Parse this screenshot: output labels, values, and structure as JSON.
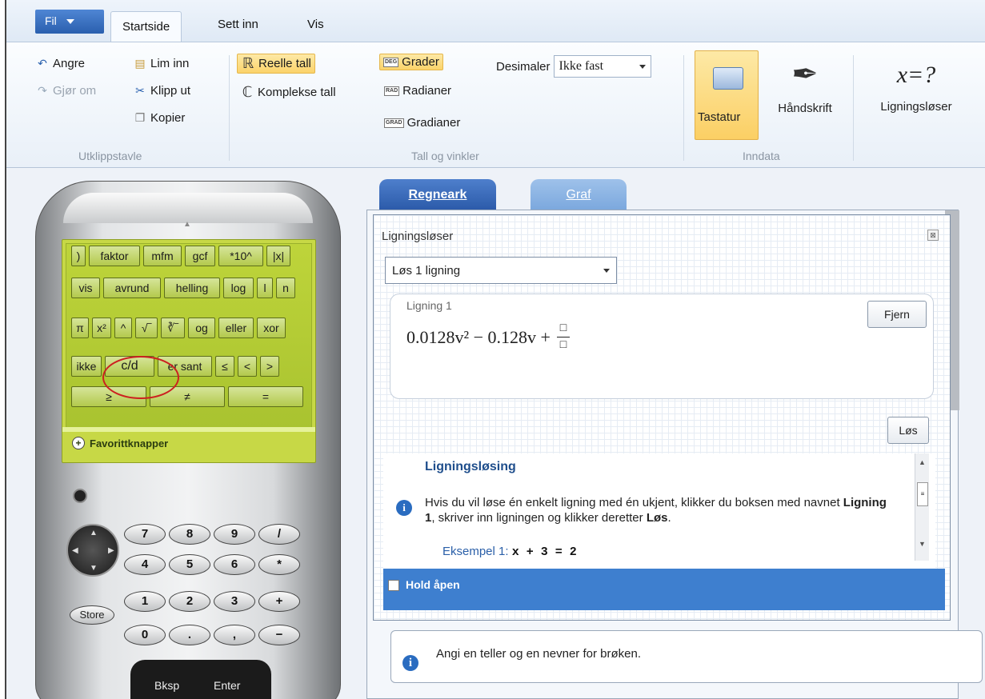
{
  "ribbon": {
    "file_menu": "Fil",
    "tabs": [
      "Startside",
      "Sett inn",
      "Vis"
    ],
    "clipboard": {
      "undo": "Angre",
      "redo": "Gjør om",
      "paste": "Lim inn",
      "cut": "Klipp ut",
      "copy": "Kopier",
      "group": "Utklippstavle"
    },
    "numbers": {
      "real": "Reelle tall",
      "complex": "Komplekse tall",
      "degrees": "Grader",
      "radians": "Radianer",
      "gradians": "Gradianer",
      "deg_badge": "DEG",
      "rad_badge": "RAD",
      "grad_badge": "GRAD",
      "decimals_label": "Desimaler",
      "decimals_value": "Ikke fast",
      "group": "Tall og vinkler"
    },
    "input": {
      "keyboard": "Tastatur",
      "handwriting": "Håndskrift",
      "group": "Inndata"
    },
    "solver": {
      "symbol": "x=?",
      "label": "Ligningsløser"
    }
  },
  "calculator": {
    "rows": [
      [
        ")",
        "faktor",
        "mfm",
        "gcf",
        "*10^",
        "|x|"
      ],
      [
        "vis",
        "avrund",
        "helling",
        "log",
        "l",
        "n"
      ],
      [
        "π",
        "x²",
        "^",
        "√‾",
        "∛‾",
        "og",
        "eller",
        "xor"
      ],
      [
        "ikke",
        "c/d",
        "er sant",
        "≤",
        "<",
        ">"
      ],
      [
        "≥",
        "≠",
        "="
      ]
    ],
    "favorites": "Favorittknapper",
    "numpad": [
      [
        "7",
        "8",
        "9",
        "/"
      ],
      [
        "4",
        "5",
        "6",
        "*"
      ],
      [
        "1",
        "2",
        "3",
        "+"
      ],
      [
        "0",
        ".",
        ",",
        "−"
      ]
    ],
    "store": "Store",
    "backspace": "Bksp",
    "enter": "Enter"
  },
  "workspace": {
    "tabs": [
      "Regneark",
      "Graf"
    ]
  },
  "solver": {
    "title": "Ligningsløser",
    "mode": "Løs 1 ligning",
    "equation_label": "Ligning 1",
    "equation_text": "0.0128v² − 0.128v +",
    "remove_button": "Fjern",
    "solve_button": "Løs",
    "help_title": "Ligningsløsing",
    "help_text_1": "Hvis du vil løse én enkelt ligning med én ukjent, klikker du boksen med navnet ",
    "help_bold_1": "Ligning 1",
    "help_text_2": ", skriver inn ligningen og klikker deretter ",
    "help_bold_2": "Løs",
    "help_text_3": ".",
    "example_label": "Eksempel 1:",
    "example_code": "x + 3 = 2",
    "keep_open": "Hold åpen"
  },
  "status": {
    "message": "Angi en teller og en nevner for brøken."
  },
  "colors": {
    "accent": "#2a5fae",
    "highlight": "#fbd36a",
    "calculator_screen": "#c7d846",
    "annotation_circle": "#cc2020"
  }
}
